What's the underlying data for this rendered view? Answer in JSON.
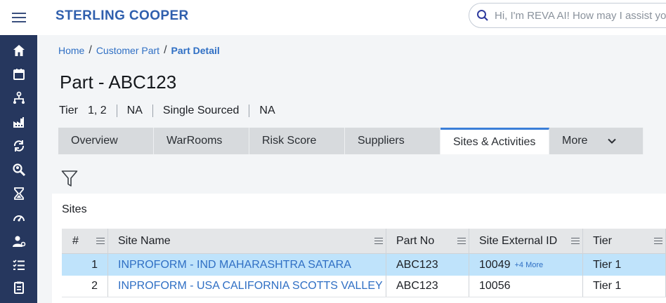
{
  "brand": "STERLING COOPER",
  "search": {
    "placeholder": "Hi, I'm REVA AI! How may I assist you?"
  },
  "sidebar": {
    "icons": [
      "home-icon",
      "calendar-icon",
      "hierarchy-icon",
      "factory-icon",
      "cycle-icon",
      "search-person-icon",
      "hourglass-icon",
      "gauge-icon",
      "user-settings-icon",
      "checklist-icon",
      "clipboard-icon"
    ]
  },
  "breadcrumb": {
    "home": "Home",
    "customer_part": "Customer Part",
    "current": "Part Detail",
    "sep": "/"
  },
  "page_title": "Part - ABC123",
  "meta": {
    "tier_label": "Tier",
    "tier_value": "1, 2",
    "field2": "NA",
    "sourcing": "Single Sourced",
    "field4": "NA"
  },
  "tabs": [
    {
      "label": "Overview"
    },
    {
      "label": "WarRooms"
    },
    {
      "label": "Risk Score"
    },
    {
      "label": "Suppliers"
    },
    {
      "label": "Sites & Activities"
    },
    {
      "label": "More"
    }
  ],
  "sites": {
    "title": "Sites",
    "columns": [
      "#",
      "Site Name",
      "Part No",
      "Site External ID",
      "Tier"
    ],
    "rows": [
      {
        "num": "1",
        "site_name": "INPROFORM - IND MAHARASHTRA SATARA",
        "part_no": "ABC123",
        "external_id": "10049",
        "more": "+4 More",
        "tier": "Tier 1"
      },
      {
        "num": "2",
        "site_name": "INPROFORM - USA CALIFORNIA SCOTTS VALLEY",
        "part_no": "ABC123",
        "external_id": "10056",
        "more": "",
        "tier": "Tier 1"
      }
    ]
  },
  "colors": {
    "sidebar": "#26375e",
    "brand": "#2f5fad",
    "link": "#2f6fc4",
    "active_tab_border": "#3a7ed8",
    "selected_row": "#bfe3fb"
  }
}
